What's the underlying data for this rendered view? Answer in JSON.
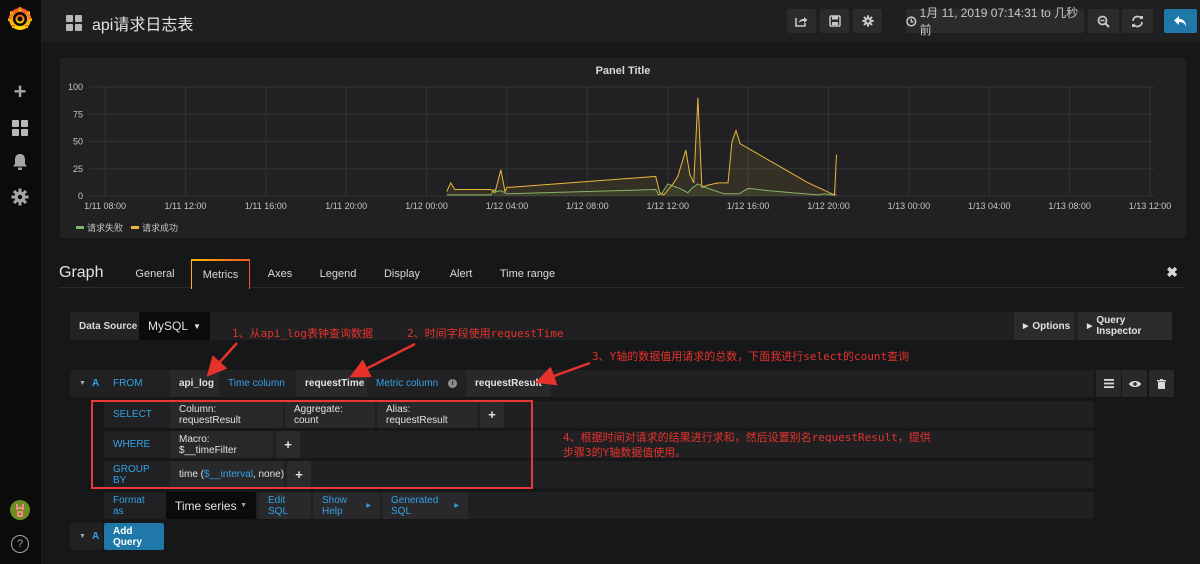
{
  "app": {
    "dashboard_title": "api请求日志表",
    "sidebar": {
      "logo_icon": "grafana-logo-icon",
      "items": [
        {
          "name": "create",
          "icon": "plus-icon",
          "glyph": "+"
        },
        {
          "name": "dashboards",
          "icon": "dashboards-grid-icon"
        },
        {
          "name": "alerting",
          "icon": "bell-icon",
          "glyph": "🔔"
        },
        {
          "name": "configuration",
          "icon": "gear-icon",
          "glyph": "⚙"
        }
      ],
      "user_avatar": "avatar",
      "help_glyph": "?"
    },
    "toolbar": {
      "share_icon": "share-icon",
      "save_icon": "save-icon",
      "settings_icon": "gear-icon",
      "time_range_label": "1月 11, 2019 07:14:31 to 几秒前",
      "zoom_out_icon": "zoom-out-icon",
      "refresh_icon": "refresh-icon",
      "back_icon": "back-arrow-icon"
    }
  },
  "panel": {
    "title": "Panel Title",
    "legend": [
      {
        "label": "请求失败",
        "color": "#7eb26d"
      },
      {
        "label": "请求成功",
        "color": "#eab839"
      }
    ]
  },
  "chart_data": {
    "type": "line",
    "title": "Panel Title",
    "xlabel": "",
    "ylabel": "",
    "ylim": [
      0,
      100
    ],
    "yticks": [
      "0",
      "25",
      "50",
      "75",
      "100"
    ],
    "xticks": [
      "1/11 08:00",
      "1/11 12:00",
      "1/11 16:00",
      "1/11 20:00",
      "1/12 00:00",
      "1/12 04:00",
      "1/12 08:00",
      "1/12 12:00",
      "1/12 16:00",
      "1/12 20:00",
      "1/13 00:00",
      "1/13 04:00",
      "1/13 08:00",
      "1/13 12:00"
    ],
    "x_unit": "hours since 1/11 08:00",
    "xlim": [
      -0.8,
      52.2
    ],
    "grid": true,
    "legend_position": "bottom-left",
    "fill": true,
    "series": [
      {
        "name": "请求失败",
        "color": "#7eb26d",
        "x": [
          17.0,
          18.0,
          18.1,
          18.2,
          19.2,
          19.35,
          19.5,
          19.7,
          20.0,
          27.4,
          27.55,
          27.7,
          28.0,
          28.6,
          29.0,
          29.2,
          29.5,
          30.0,
          30.8,
          31.4,
          31.55,
          32.0,
          33.0,
          34.2,
          35.5,
          35.8,
          36.2,
          36.4
        ],
        "values": [
          1,
          1,
          1,
          1,
          1,
          6,
          4,
          5,
          2,
          6,
          1,
          2,
          11,
          7,
          3,
          7,
          11,
          7,
          2,
          2,
          2,
          7,
          5,
          3,
          1,
          2,
          1,
          1
        ]
      },
      {
        "name": "请求成功",
        "color": "#eab839",
        "x": [
          17.0,
          17.2,
          17.4,
          18.0,
          19.2,
          19.4,
          19.7,
          19.9,
          20.0,
          20.2,
          27.4,
          27.6,
          27.8,
          28.3,
          28.5,
          28.9,
          29.1,
          29.3,
          29.5,
          29.7,
          30.0,
          30.5,
          30.8,
          31.0,
          31.2,
          31.4,
          31.6,
          35.0,
          36.3,
          36.4
        ],
        "values": [
          4,
          12,
          6,
          6,
          6,
          3,
          24,
          4,
          8,
          8,
          18,
          3,
          1,
          12,
          18,
          42,
          20,
          12,
          90,
          8,
          10,
          12,
          12,
          12,
          50,
          60,
          48,
          12,
          1,
          38
        ]
      }
    ]
  },
  "editor": {
    "title": "Graph",
    "close_glyph": "✖",
    "tabs": [
      {
        "label": "General",
        "active": false
      },
      {
        "label": "Metrics",
        "active": true
      },
      {
        "label": "Axes",
        "active": false
      },
      {
        "label": "Legend",
        "active": false
      },
      {
        "label": "Display",
        "active": false
      },
      {
        "label": "Alert",
        "active": false
      },
      {
        "label": "Time range",
        "active": false
      }
    ],
    "datasource_label": "Data Source",
    "datasource_value": "MySQL",
    "options_button": "Options",
    "query_inspector_button": "Query Inspector",
    "query": {
      "ref_id": "A",
      "from_label": "FROM",
      "table": "api_log",
      "time_column_label": "Time column",
      "time_column": "requestTime",
      "metric_column_label": "Metric column",
      "metric_column": "requestResult",
      "select_label": "SELECT",
      "select_parts": [
        "Column: requestResult",
        "Aggregate: count",
        "Alias: requestResult"
      ],
      "where_label": "WHERE",
      "where_parts": [
        "Macro: $__timeFilter"
      ],
      "group_by_label": "GROUP BY",
      "group_by_prefix": "time (",
      "group_by_interval": "$__interval",
      "group_by_suffix": ", none)",
      "format_as_label": "Format as",
      "format_as_value": "Time series",
      "edit_sql": "Edit SQL",
      "show_help": "Show Help",
      "generated_sql": "Generated SQL",
      "plus": "+"
    },
    "add_query": {
      "ref_id": "A",
      "label": "Add Query"
    }
  },
  "annotations": {
    "note1": "1、从api_log表钟查询数据",
    "note2": "2、时间字段使用requestTime",
    "note3": "3、Y轴的数据值用请求的总数，下面我进行select的count查询",
    "note4_line1": "4、根据时间对请求的结果进行求和，然后设置别名requestResult，提供",
    "note4_line2": "步骤3的Y轴数据值使用。"
  }
}
